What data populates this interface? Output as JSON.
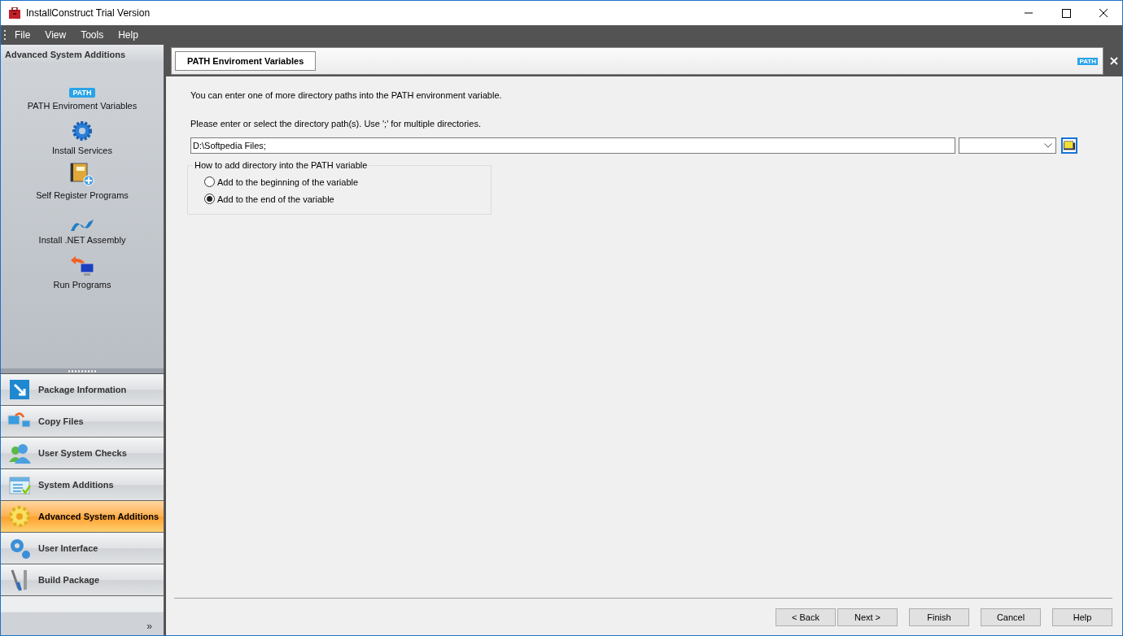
{
  "window": {
    "title": "InstallConstruct Trial Version"
  },
  "menu": [
    "File",
    "View",
    "Tools",
    "Help"
  ],
  "sidebar": {
    "title": "Advanced System Additions",
    "items": [
      {
        "kind": "path",
        "label": "PATH Enviroment Variables",
        "badge": "PATH"
      },
      {
        "kind": "gear",
        "label": "Install Services"
      },
      {
        "kind": "book",
        "label": "Self Register Programs"
      },
      {
        "kind": "net",
        "label": "Install .NET Assembly"
      },
      {
        "kind": "run",
        "label": "Run Programs"
      }
    ],
    "nav": [
      {
        "kind": "package",
        "label": "Package Information",
        "selected": false
      },
      {
        "kind": "copy",
        "label": "Copy Files",
        "selected": false
      },
      {
        "kind": "users",
        "label": "User System Checks",
        "selected": false
      },
      {
        "kind": "system",
        "label": "System Additions",
        "selected": false
      },
      {
        "kind": "sun",
        "label": "Advanced System Additions",
        "selected": true
      },
      {
        "kind": "gears",
        "label": "User Interface",
        "selected": false
      },
      {
        "kind": "tools",
        "label": "Build Package",
        "selected": false
      }
    ],
    "overflow": "»"
  },
  "panel": {
    "tab": "PATH Enviroment Variables",
    "badge": "PATH",
    "intro": "You can enter one of more directory paths into the PATH environment variable.",
    "prompt": "Please enter or select the directory path(s).  Use ';' for multiple directories.",
    "path_value": "D:\\Softpedia Files;",
    "group": {
      "legend": "How to add directory into the PATH variable",
      "options": [
        {
          "label": "Add to the beginning of the variable",
          "selected": false
        },
        {
          "label": "Add to the end of the variable",
          "selected": true
        }
      ]
    }
  },
  "buttons": [
    "< Back",
    "Next >",
    "Finish",
    "Cancel",
    "Help"
  ]
}
